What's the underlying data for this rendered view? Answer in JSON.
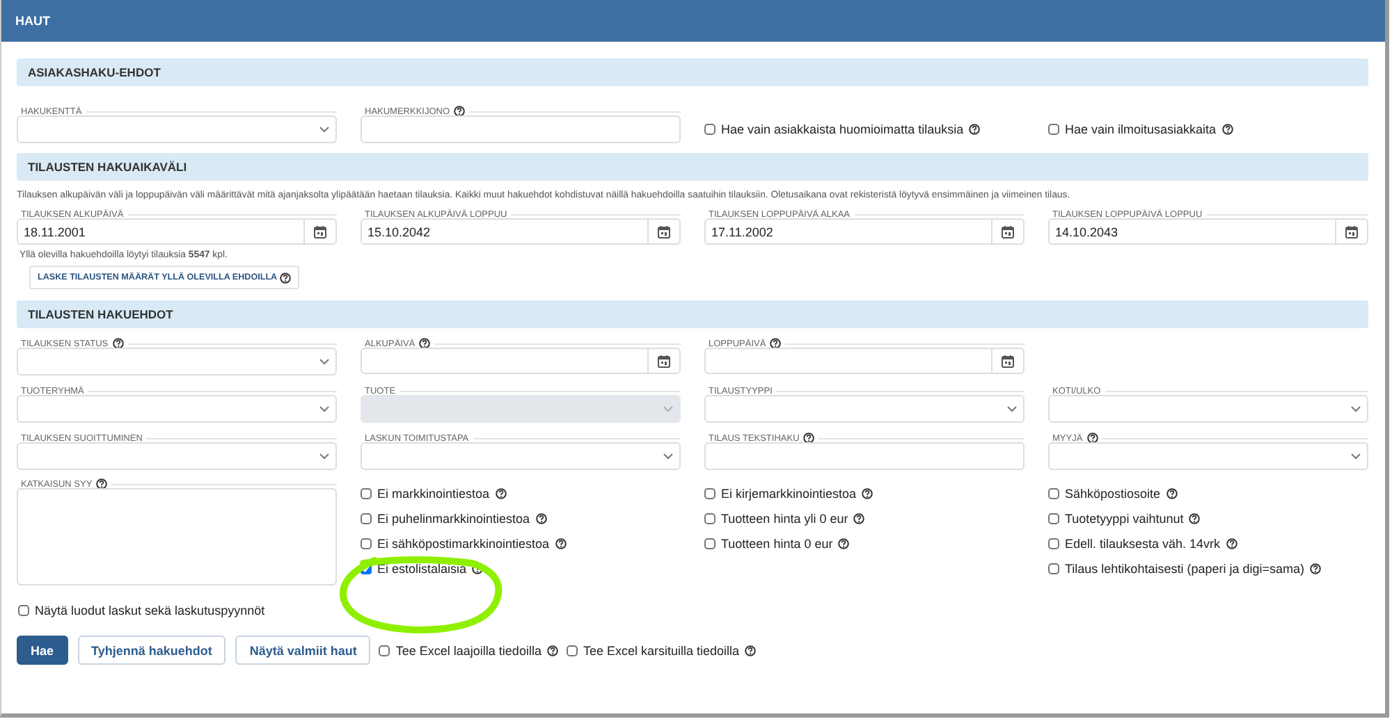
{
  "header": {
    "title": "HAUT"
  },
  "customer_section": {
    "heading": "ASIAKASHAKU-EHDOT",
    "row": [
      {
        "kind": "select",
        "label": "HAKUKENTTÄ",
        "help": false,
        "disabled": false
      },
      {
        "kind": "text",
        "label": "HAKUMERKKIJONO",
        "help": true
      },
      {
        "kind": "checkbox",
        "label": "Hae vain asiakkaista huomioimatta tilauksia",
        "help": true,
        "checked": false
      },
      {
        "kind": "checkbox",
        "label": "Hae vain ilmoitusasiakkaita",
        "help": true,
        "checked": false
      }
    ]
  },
  "period_section": {
    "heading": "TILAUSTEN HAKUAIKAVÄLI",
    "description": "Tilauksen alkupäivän väli ja loppupäivän väli määrittävät mitä ajanjaksolta ylipäätään haetaan tilauksia. Kaikki muut hakuehdot kohdistuvat näillä hakuehdoilla saatuihin tilauksiin. Oletusaikana ovat rekisteristä löytyvä ensimmäinen ja viimeinen tilaus.",
    "row": [
      {
        "kind": "date",
        "label": "TILAUKSEN ALKUPÄIVÄ",
        "help": false,
        "value": "18.11.2001"
      },
      {
        "kind": "date",
        "label": "TILAUKSEN ALKUPÄIVÄ LOPPUU",
        "help": false,
        "value": "15.10.2042"
      },
      {
        "kind": "date",
        "label": "TILAUKSEN LOPPUPÄIVÄ ALKAA",
        "help": false,
        "value": "17.11.2002"
      },
      {
        "kind": "date",
        "label": "TILAUKSEN LOPPUPÄIVÄ LOPPUU",
        "help": false,
        "value": "14.10.2043"
      }
    ],
    "result": "Yllä olevilla hakuehdoilla löytyi tilauksia **5547** kpl.",
    "count_button": {
      "label": "LASKE TILAUSTEN MÄÄRÄT YLLÄ OLEVILLA EHDOILLA",
      "help": true
    }
  },
  "criteria_section": {
    "heading": "TILAUSTEN HAKUEHDOT",
    "rows": [
      [
        {
          "kind": "select",
          "label": "TILAUKSEN STATUS",
          "help": true,
          "disabled": false
        },
        {
          "kind": "date",
          "label": "ALKUPÄIVÄ",
          "help": true
        },
        {
          "kind": "date",
          "label": "LOPPUPÄIVÄ",
          "help": true
        }
      ],
      [
        {
          "kind": "select",
          "label": "TUOTERYHMÄ",
          "help": false,
          "disabled": false
        },
        {
          "kind": "select",
          "label": "TUOTE",
          "help": false,
          "disabled": true
        },
        {
          "kind": "select",
          "label": "TILAUSTYYPPI",
          "help": false,
          "disabled": false
        },
        {
          "kind": "select",
          "label": "KOTI/ULKO",
          "help": false,
          "disabled": false
        }
      ],
      [
        {
          "kind": "select",
          "label": "TILAUKSEN SUOITTUMINEN",
          "help": false,
          "disabled": false
        },
        {
          "kind": "select",
          "label": "LASKUN TOIMITUSTAPA",
          "help": false,
          "disabled": false
        },
        {
          "kind": "text",
          "label": "TILAUS TEKSTIHAKU",
          "help": true
        },
        {
          "kind": "select",
          "label": "MYYJÄ",
          "help": true,
          "disabled": false
        }
      ]
    ],
    "reason_field": {
      "label": "KATKAISUN SYY",
      "help": true
    },
    "checkbox_columns": [
      [
        {
          "label": "Ei markkinointiestoa",
          "help": true,
          "checked": false
        },
        {
          "label": "Ei puhelinmarkkinointiestoa",
          "help": true,
          "checked": false
        },
        {
          "label": "Ei sähköpostimarkkinointiestoa",
          "help": true,
          "checked": false
        },
        {
          "label": "Ei estolistalaisia",
          "help": true,
          "checked": true
        }
      ],
      [
        {
          "label": "Ei kirjemarkkinointiestoa",
          "help": true,
          "checked": false
        },
        {
          "label": "Tuotteen hinta yli 0 eur",
          "help": true,
          "checked": false
        },
        {
          "label": "Tuotteen hinta 0 eur",
          "help": true,
          "checked": false
        }
      ],
      [
        {
          "label": "Sähköpostiosoite",
          "help": true,
          "checked": false
        },
        {
          "label": "Tuotetyyppi vaihtunut",
          "help": true,
          "checked": false
        },
        {
          "label": "Edell. tilauksesta väh. 14vrk",
          "help": true,
          "checked": false
        },
        {
          "label": "Tilaus lehtikohtaisesti (paperi ja digi=sama)",
          "help": true,
          "checked": false
        }
      ]
    ],
    "invoice_checkbox": {
      "label": "Näytä luodut laskut sekä laskutuspyynnöt",
      "help": false,
      "checked": false
    }
  },
  "actions": [
    {
      "kind": "primary",
      "label": "Hae"
    },
    {
      "kind": "secondary",
      "label": "Tyhjennä hakuehdot"
    },
    {
      "kind": "secondary",
      "label": "Näytä valmiit haut"
    },
    {
      "kind": "checkbox",
      "label": "Tee Excel laajoilla tiedoilla",
      "help": true,
      "checked": false
    },
    {
      "kind": "checkbox",
      "label": "Tee Excel karsituilla tiedoilla",
      "help": true,
      "checked": false
    }
  ],
  "annotation": {
    "kind": "circle"
  }
}
